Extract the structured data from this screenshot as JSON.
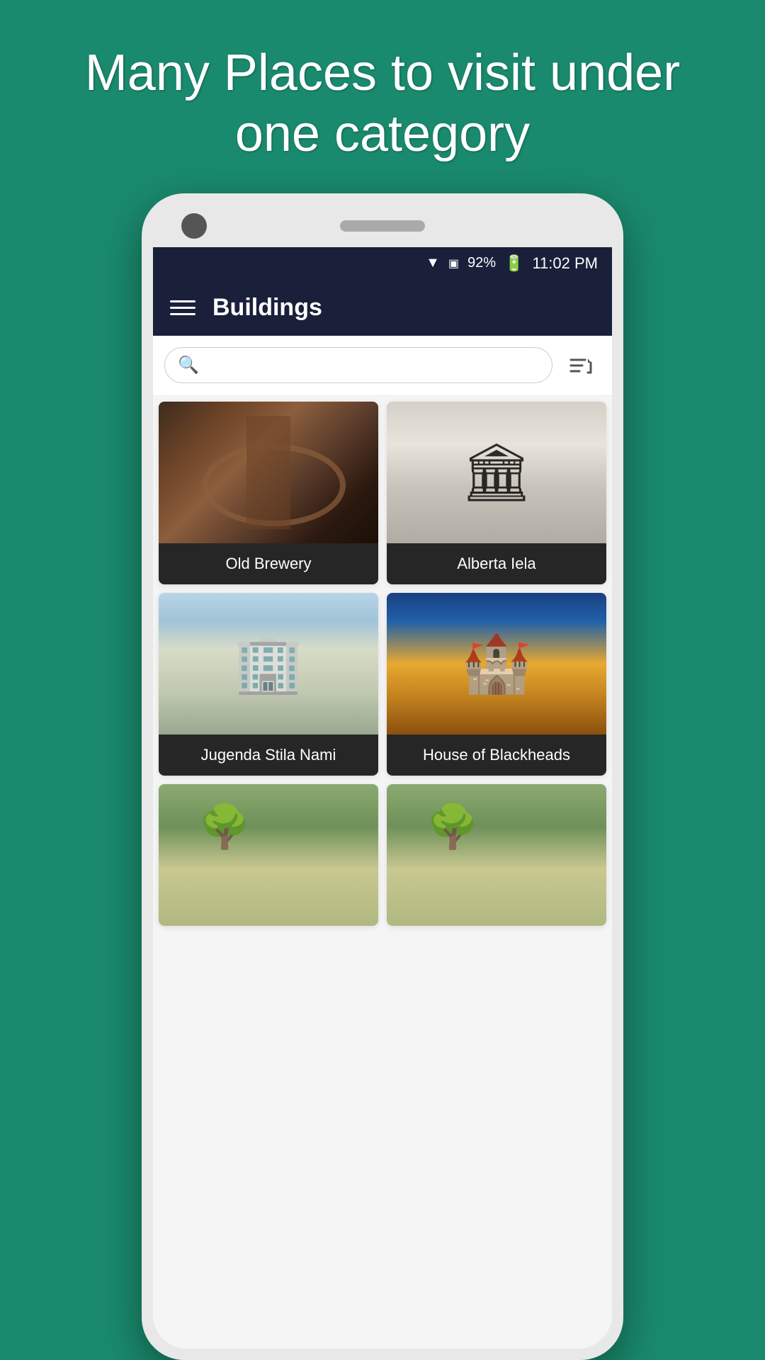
{
  "page": {
    "background_color": "#1a8a6e",
    "headline": "Many Places to visit under one category"
  },
  "status_bar": {
    "wifi": "▼",
    "signal": "N",
    "battery_percent": "92%",
    "battery_icon": "🔋",
    "time": "11:02 PM"
  },
  "app_bar": {
    "title": "Buildings",
    "menu_icon": "hamburger"
  },
  "search": {
    "placeholder": "",
    "sort_icon": "sort"
  },
  "grid": {
    "items": [
      {
        "id": "old-brewery",
        "label": "Old Brewery",
        "image_type": "old-brewery"
      },
      {
        "id": "alberta-iela",
        "label": "Alberta Iela",
        "image_type": "alberta"
      },
      {
        "id": "jugenda-stila-nami",
        "label": "Jugenda Stila Nami",
        "image_type": "jugenda"
      },
      {
        "id": "house-of-blackheads",
        "label": "House of Blackheads",
        "image_type": "blackheads"
      }
    ]
  }
}
